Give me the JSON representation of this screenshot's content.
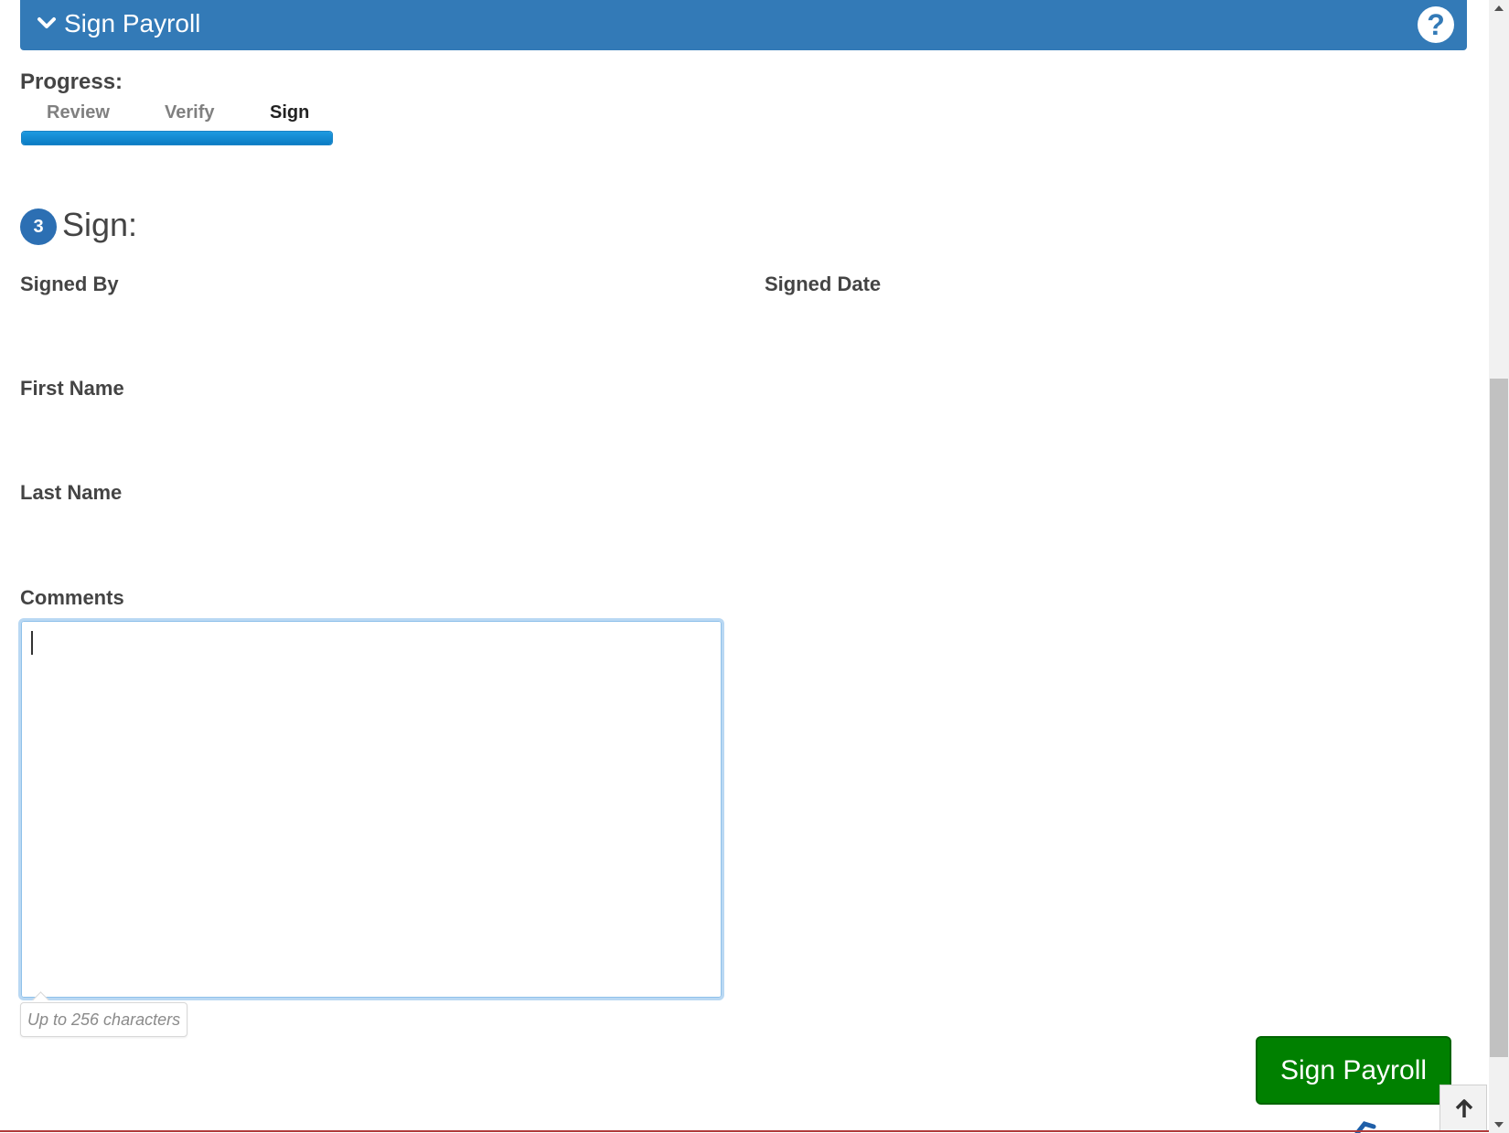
{
  "header": {
    "title": "Sign Payroll",
    "collapse_icon": "chevron-down-icon",
    "help_icon": "question-circle-icon",
    "help_label": "?",
    "color": "#337ab7"
  },
  "progress": {
    "label": "Progress:",
    "steps": [
      {
        "label": "Review",
        "state": "done"
      },
      {
        "label": "Verify",
        "state": "done"
      },
      {
        "label": "Sign",
        "state": "current"
      }
    ],
    "percent": 100,
    "bar_color": "#0b7cc4"
  },
  "section": {
    "step_number": "3",
    "title": "Sign:"
  },
  "fields": {
    "signed_by_label": "Signed By",
    "signed_date_label": "Signed Date",
    "first_name_label": "First Name",
    "last_name_label": "Last Name",
    "comments_label": "Comments",
    "comments_value": "",
    "comments_hint": "Up to 256 characters"
  },
  "actions": {
    "sign_button_label": "Sign Payroll",
    "sign_button_color": "#008000",
    "scroll_top_icon": "arrow-up-icon"
  }
}
